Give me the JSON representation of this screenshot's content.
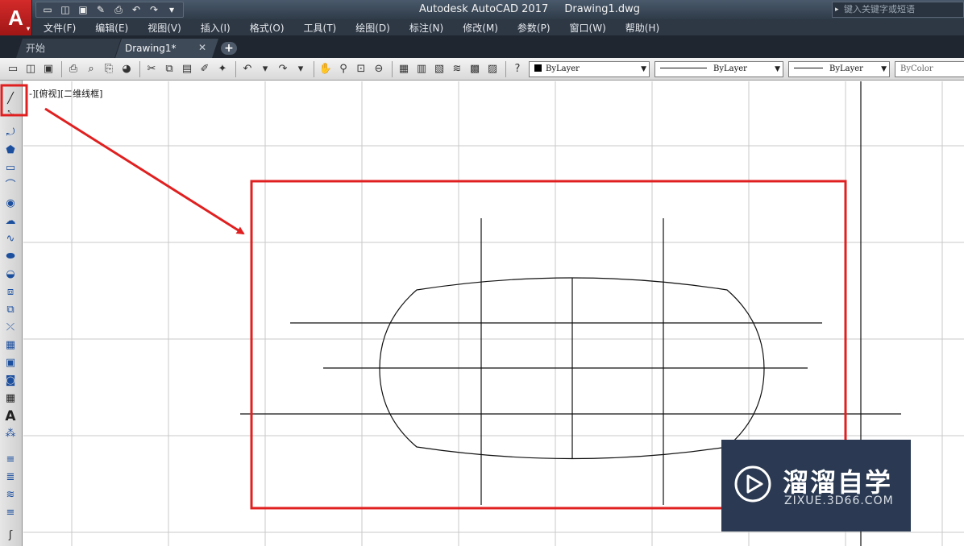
{
  "app": {
    "logo_letter": "A",
    "title": "Autodesk AutoCAD 2017",
    "file_name": "Drawing1.dwg",
    "search_placeholder": "键入关键字或短语"
  },
  "menu": [
    "文件(F)",
    "编辑(E)",
    "视图(V)",
    "插入(I)",
    "格式(O)",
    "工具(T)",
    "绘图(D)",
    "标注(N)",
    "修改(M)",
    "参数(P)",
    "窗口(W)",
    "帮助(H)"
  ],
  "tabs": {
    "start": "开始",
    "drawing": "Drawing1*",
    "close_glyph": "✕",
    "add_glyph": "+"
  },
  "properties": {
    "color": "ByLayer",
    "linetype": "ByLayer",
    "lineweight": "ByLayer",
    "plotstyle": "ByColor"
  },
  "viewport_label": "-][俯视][二维线框]",
  "watermark": {
    "text_cn": "溜溜自学",
    "text_en": "ZIXUE.3D66.COM"
  },
  "colors": {
    "highlight": "#e02020",
    "watermark_bg": "#2b3a52",
    "grid": "#c8c8c8",
    "title_bg": "#3a4654"
  },
  "icons": {
    "qa": [
      "new-icon",
      "open-icon",
      "save-icon",
      "saveas-icon",
      "print-icon",
      "undo-icon",
      "redo-icon",
      "dropdown-icon"
    ],
    "left_toolbar": [
      "line-icon",
      "xline-icon",
      "polyline-icon",
      "polygon-icon",
      "rectangle-icon",
      "arc-icon",
      "circle-icon",
      "revcloud-icon",
      "spline-icon",
      "ellipse-icon",
      "ellipse-arc-icon",
      "insert-block-icon",
      "make-block-icon",
      "point-icon",
      "hatch-icon",
      "gradient-icon",
      "region-icon",
      "table-icon",
      "text-icon",
      "add-selected-icon"
    ]
  }
}
